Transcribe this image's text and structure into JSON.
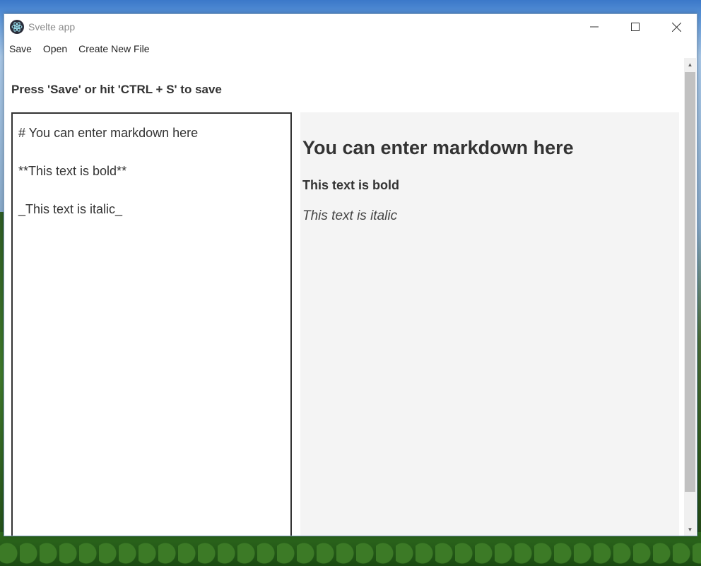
{
  "window": {
    "title": "Svelte app",
    "controls": {
      "minimize": "—",
      "maximize": "☐",
      "close": "✕"
    }
  },
  "menu": {
    "items": [
      {
        "label": "Save"
      },
      {
        "label": "Open"
      },
      {
        "label": "Create New File"
      }
    ]
  },
  "instruction": "Press 'Save' or hit 'CTRL + S' to save",
  "editor": {
    "lines": [
      "# You can enter markdown here",
      "**This text is bold**",
      "_This text is italic_"
    ]
  },
  "preview": {
    "heading": "You can enter markdown here",
    "bold": "This text is bold",
    "italic": "This text is italic"
  },
  "icons": {
    "app": "electron-icon",
    "scroll_up": "chevron-up-icon",
    "scroll_down": "chevron-down-icon"
  }
}
